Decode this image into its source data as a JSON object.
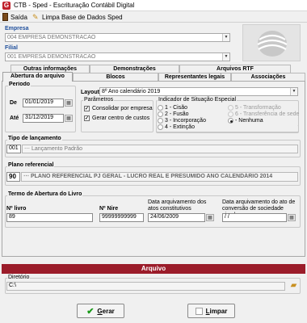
{
  "window": {
    "title": "CTB - Sped - Escrituração Contábil Digital",
    "app_icon": "G"
  },
  "toolbar": {
    "exit_label": "Saída",
    "clear_db_label": "Limpa Base de Dados Sped"
  },
  "empresa": {
    "label": "Empresa",
    "value": "004 EMPRESA DEMONSTRACAO"
  },
  "filial": {
    "label": "Filial",
    "value": "001 EMPRESA DEMONSTRACAO"
  },
  "tabs": {
    "row1": [
      "Outras informações",
      "Demonstrações",
      "Arquivos RTF"
    ],
    "row2": [
      "Abertura do arquivo",
      "Blocos",
      "Representantes legais",
      "Associações"
    ],
    "active": "Abertura do arquivo"
  },
  "periodo": {
    "title": "Período",
    "de_label": "De",
    "de_value": "01/01/2019",
    "ate_label": "Até",
    "ate_value": "31/12/2019"
  },
  "layout": {
    "label": "Layout",
    "value": "8º Ano calendário 2019"
  },
  "parametros": {
    "title": "Parâmetros",
    "consolidar": "Consolidar por empresa",
    "gerar_centro": "Gerar centro de custos"
  },
  "indicador": {
    "title": "Indicador de Situação Especial",
    "options": [
      "1 - Cisão",
      "2 - Fusão",
      "3 - Incorporação",
      "4 - Extinção",
      "5 - Transformação",
      "6 - Transferência de sede",
      "- Nenhuma"
    ]
  },
  "tipo_lancamento": {
    "title": "Tipo de lançamento",
    "code": "001",
    "desc": "Lançamento Padrão"
  },
  "plano": {
    "title": "Plano referencial",
    "code": "90",
    "desc": "PLANO REFERENCIAL PJ GERAL - LUCRO REAL E PRESUMIDO ANO CALENDÁRIO 2014"
  },
  "termo": {
    "title": "Termo de Abertura do Livro",
    "livro_label": "Nº livro",
    "livro_value": "89",
    "nire_label": "Nº Nire",
    "nire_value": "99999999999",
    "data_arq_label": "Data arquivamento dos atos constitutivos",
    "data_arq_value": "24/06/2009",
    "data_conv_label": "Data arquivamento do ato de conversão de sociedade simples",
    "data_conv_value": "/ /"
  },
  "arquivo": {
    "section_label": "Arquivo",
    "dir_label": "Diretório",
    "dir_value": "C:\\"
  },
  "buttons": {
    "gerar_hot": "G",
    "gerar_rest": "erar",
    "limpar_hot": "L",
    "limpar_rest": "impar"
  },
  "colors": {
    "accent": "#1f4f9c",
    "arquivo_bar": "#9b1c2a"
  }
}
